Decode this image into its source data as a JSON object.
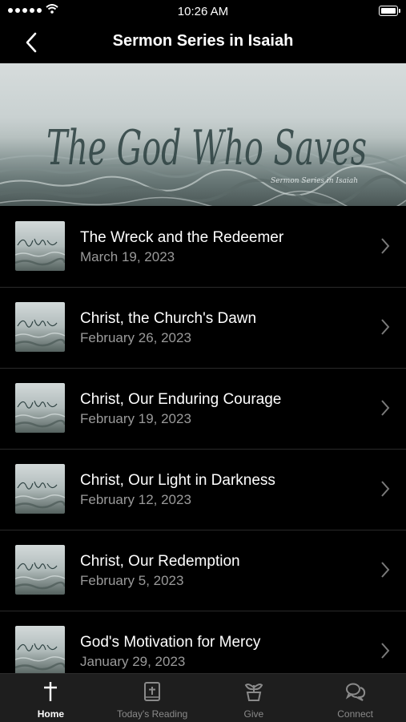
{
  "status_bar": {
    "time": "10:26 AM"
  },
  "nav": {
    "title": "Sermon Series in Isaiah",
    "back_icon": "chevron-left-icon"
  },
  "hero": {
    "script_title": "The God Who Saves",
    "subtitle": "Sermon Series in Isaiah"
  },
  "sermons": [
    {
      "title": "The Wreck and the Redeemer",
      "date": "March 19, 2023"
    },
    {
      "title": "Christ, the Church's Dawn",
      "date": "February 26, 2023"
    },
    {
      "title": "Christ, Our Enduring Courage",
      "date": "February 19, 2023"
    },
    {
      "title": "Christ, Our Light in Darkness",
      "date": "February 12, 2023"
    },
    {
      "title": "Christ, Our Redemption",
      "date": "February 5, 2023"
    },
    {
      "title": "God's Motivation for Mercy",
      "date": "January 29, 2023"
    }
  ],
  "tabs": [
    {
      "label": "Home",
      "icon": "cross-icon",
      "active": true
    },
    {
      "label": "Today's Reading",
      "icon": "bible-icon",
      "active": false
    },
    {
      "label": "Give",
      "icon": "plant-icon",
      "active": false
    },
    {
      "label": "Connect",
      "icon": "chat-icon",
      "active": false
    }
  ],
  "colors": {
    "background": "#000000",
    "tab_bar": "#1e1e1e",
    "date_text": "#9a9a9a",
    "inactive_tab": "#8a8a8a"
  }
}
